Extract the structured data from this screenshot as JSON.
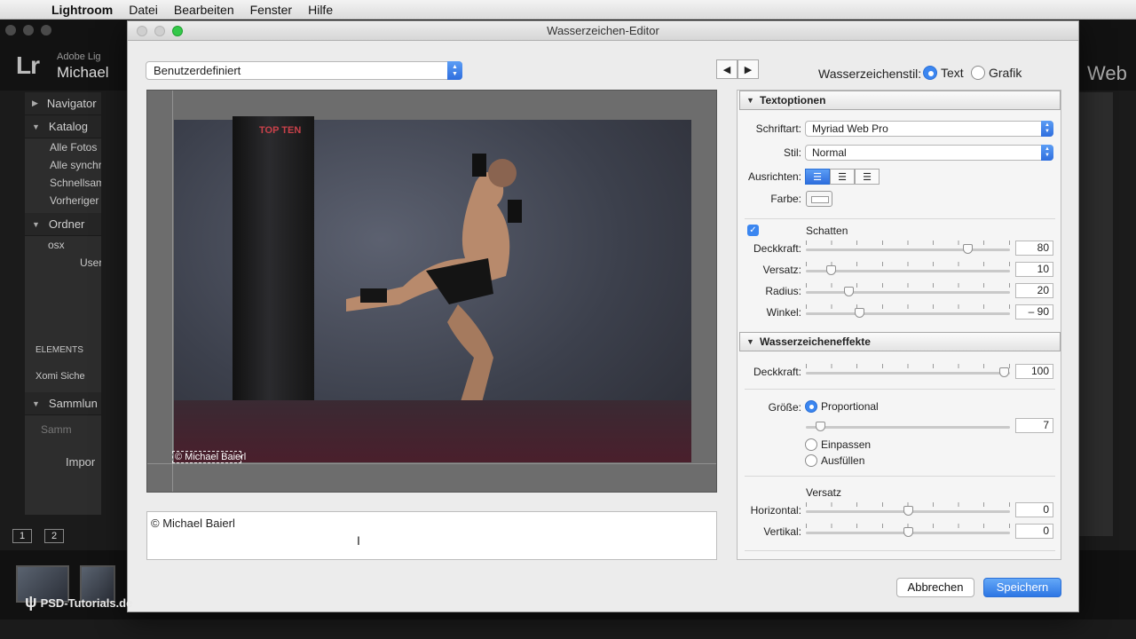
{
  "menubar": {
    "app": "Lightroom",
    "items": [
      "Datei",
      "Bearbeiten",
      "Fenster",
      "Hilfe"
    ]
  },
  "lightroom": {
    "logo": "Lr",
    "adobe": "Adobe Lig",
    "user": "Michael",
    "module": "Web",
    "left_panel": {
      "navigator": "Navigator",
      "catalog": "Katalog",
      "catalog_items": [
        "Alle Fotos",
        "Alle synchr",
        "Schnellsam",
        "Vorheriger"
      ],
      "folders": "Ordner",
      "folder_items": [
        "osx",
        "User"
      ],
      "elements": "ELEMENTS",
      "xomi": "Xomi Siche",
      "collections": "Sammlun",
      "search_placeholder": "Samm",
      "import": "Impor"
    },
    "pages": [
      "1",
      "2"
    ]
  },
  "dialog": {
    "title": "Wasserzeichen-Editor",
    "preset": "Benutzerdefiniert",
    "nav_prev": "◀",
    "nav_next": "▶",
    "style_label": "Wasserzeichenstil:",
    "style_text": "Text",
    "style_graphic": "Grafik",
    "watermark_preview": "© Michael Baierl",
    "bag_text": "TOP TEN",
    "watermark_text": "© Michael Baierl",
    "text_options": {
      "header": "Textoptionen",
      "font_label": "Schriftart:",
      "font_value": "Myriad Web Pro",
      "style_label": "Stil:",
      "style_value": "Normal",
      "align_label": "Ausrichten:",
      "color_label": "Farbe:"
    },
    "shadow": {
      "label": "Schatten",
      "opacity_label": "Deckkraft:",
      "opacity": "80",
      "offset_label": "Versatz:",
      "offset": "10",
      "radius_label": "Radius:",
      "radius": "20",
      "angle_label": "Winkel:",
      "angle": "– 90"
    },
    "effects": {
      "header": "Wasserzeicheneffekte",
      "opacity_label": "Deckkraft:",
      "opacity": "100",
      "size_label": "Größe:",
      "size_proportional": "Proportional",
      "size_value": "7",
      "size_fit": "Einpassen",
      "size_fill": "Ausfüllen",
      "inset_label": "Versatz",
      "horizontal_label": "Horizontal:",
      "horizontal": "0",
      "vertical_label": "Vertikal:",
      "vertical": "0"
    },
    "cancel": "Abbrechen",
    "save": "Speichern"
  },
  "branding": "PSD-Tutorials.de"
}
